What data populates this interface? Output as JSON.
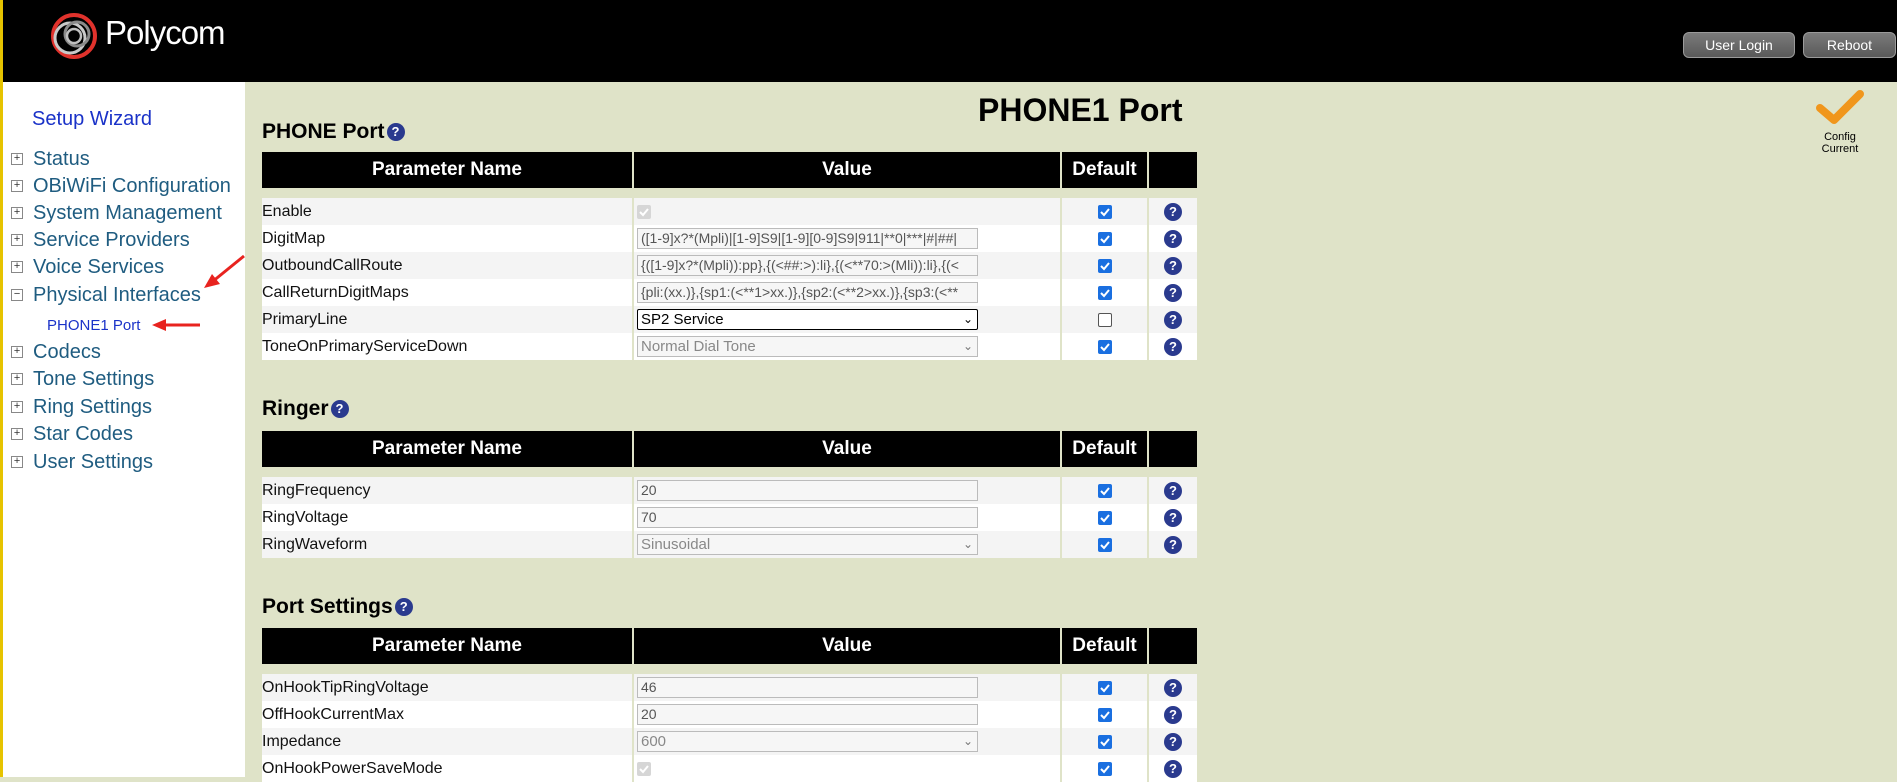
{
  "header": {
    "logo_text": "Polycom",
    "user_login_label": "User Login",
    "reboot_label": "Reboot"
  },
  "sidebar": {
    "setup_wizard": "Setup Wizard",
    "items": [
      {
        "label": "Status",
        "toggle": "+"
      },
      {
        "label": "OBiWiFi Configuration",
        "toggle": "+"
      },
      {
        "label": "System Management",
        "toggle": "+"
      },
      {
        "label": "Service Providers",
        "toggle": "+"
      },
      {
        "label": "Voice Services",
        "toggle": "+"
      },
      {
        "label": "Physical Interfaces",
        "toggle": "−"
      },
      {
        "label": "Codecs",
        "toggle": "+"
      },
      {
        "label": "Tone Settings",
        "toggle": "+"
      },
      {
        "label": "Ring Settings",
        "toggle": "+"
      },
      {
        "label": "Star Codes",
        "toggle": "+"
      },
      {
        "label": "User Settings",
        "toggle": "+"
      }
    ],
    "sub_item": "PHONE1 Port"
  },
  "main": {
    "page_title": "PHONE1 Port",
    "config_status": "Config Current",
    "columns": {
      "param": "Parameter Name",
      "value": "Value",
      "default": "Default"
    },
    "sections": [
      {
        "title": "PHONE Port",
        "rows": [
          {
            "name": "Enable",
            "type": "checkbox",
            "value": "",
            "default": true
          },
          {
            "name": "DigitMap",
            "type": "text",
            "value": "([1-9]x?*(Mpli)|[1-9]S9|[1-9][0-9]S9|911|**0|***|#|##|",
            "default": true
          },
          {
            "name": "OutboundCallRoute",
            "type": "text",
            "value": "{([1-9]x?*(Mpli)):pp},{(<##:>):li},{(<**70:>(Mli)):li},{(<",
            "default": true
          },
          {
            "name": "CallReturnDigitMaps",
            "type": "text",
            "value": "{pli:(xx.)},{sp1:(<**1>xx.)},{sp2:(<**2>xx.)},{sp3:(<**",
            "default": true
          },
          {
            "name": "PrimaryLine",
            "type": "select-active",
            "value": "SP2 Service",
            "default": false
          },
          {
            "name": "ToneOnPrimaryServiceDown",
            "type": "select",
            "value": "Normal Dial Tone",
            "default": true
          }
        ]
      },
      {
        "title": "Ringer",
        "rows": [
          {
            "name": "RingFrequency",
            "type": "text",
            "value": "20",
            "default": true
          },
          {
            "name": "RingVoltage",
            "type": "text",
            "value": "70",
            "default": true
          },
          {
            "name": "RingWaveform",
            "type": "select",
            "value": "Sinusoidal",
            "default": true
          }
        ]
      },
      {
        "title": "Port Settings",
        "rows": [
          {
            "name": "OnHookTipRingVoltage",
            "type": "text",
            "value": "46",
            "default": true
          },
          {
            "name": "OffHookCurrentMax",
            "type": "text",
            "value": "20",
            "default": true
          },
          {
            "name": "Impedance",
            "type": "select",
            "value": "600",
            "default": true
          },
          {
            "name": "OnHookPowerSaveMode",
            "type": "checkbox",
            "value": "",
            "default": true
          }
        ]
      }
    ]
  },
  "colors": {
    "header_bg": "#000000",
    "page_bg": "#dfe3c8",
    "accent_yellow": "#e6c300",
    "checkbox_blue": "#1a6fe0",
    "help_icon": "#2a3a8e",
    "annotation_red": "#e8231f"
  }
}
